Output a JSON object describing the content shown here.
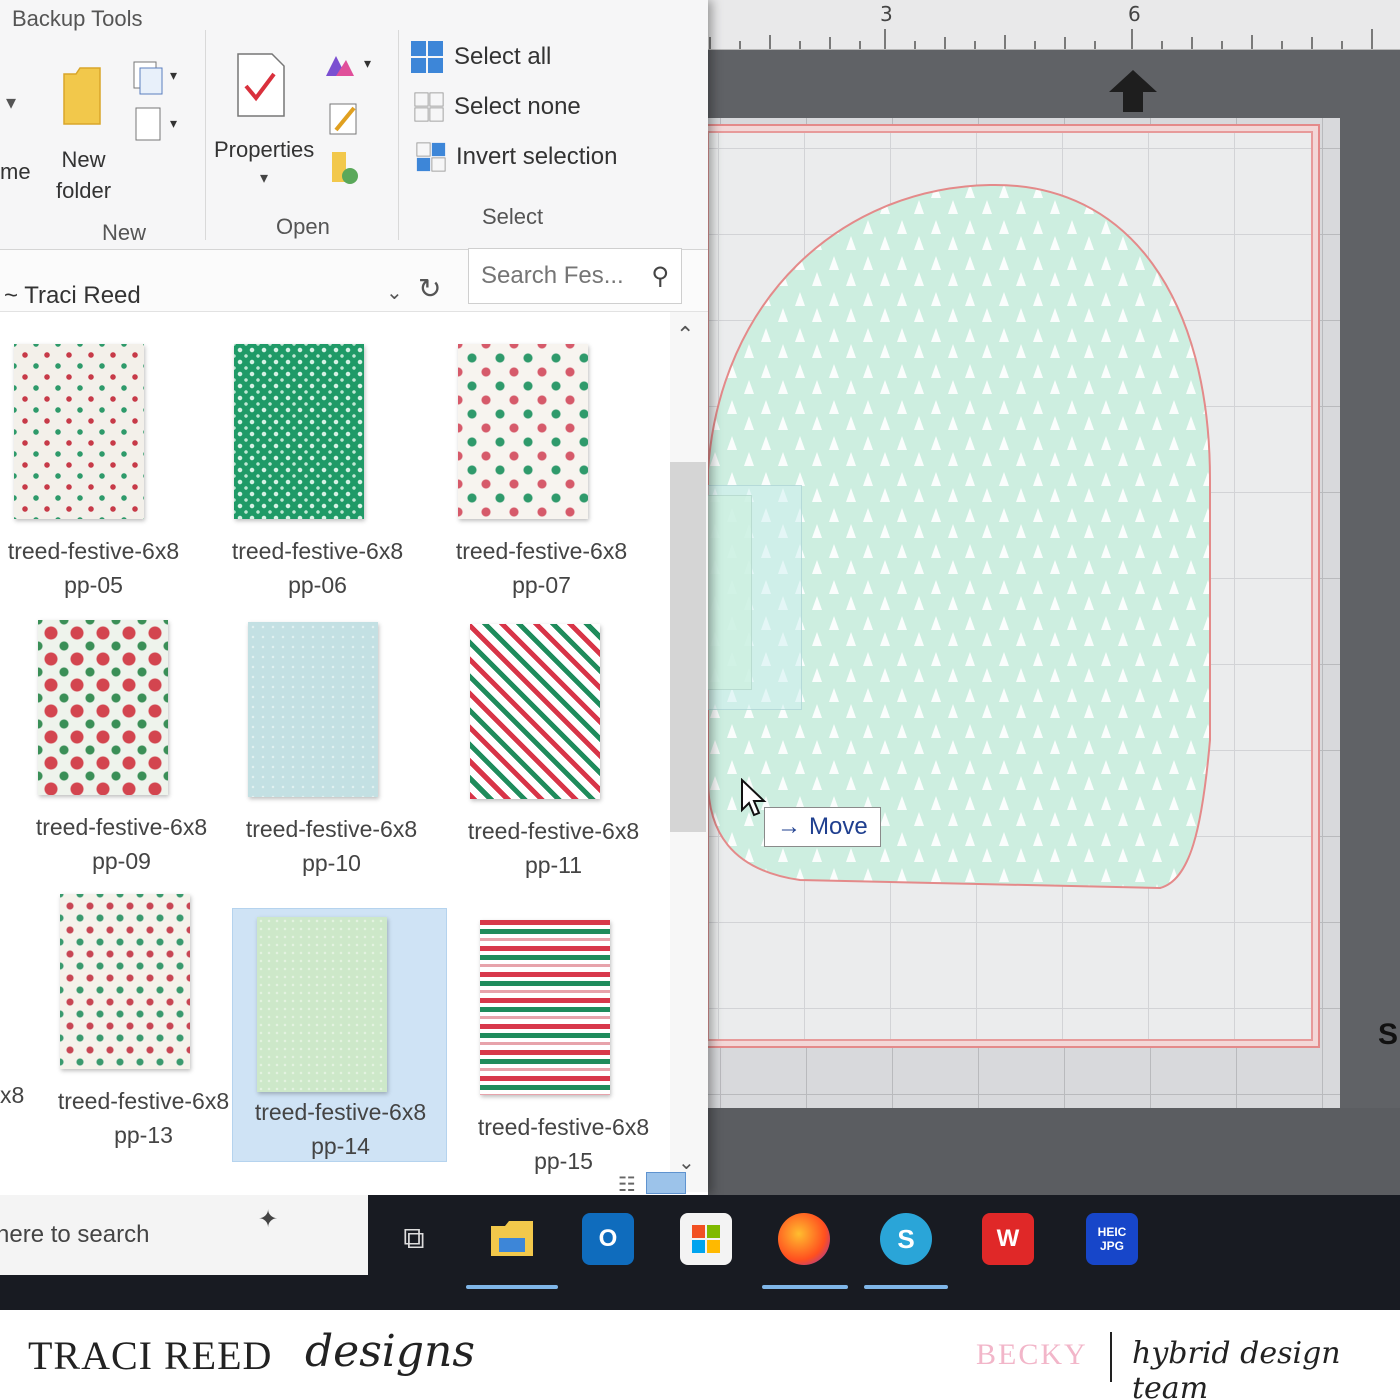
{
  "ribbon": {
    "tab_title": "Backup Tools",
    "new_partial_label": "me",
    "new_folder_label": "New\nfolder",
    "properties_label": "Properties",
    "group_new": "New",
    "group_open": "Open",
    "group_select": "Select",
    "select_all": "Select all",
    "select_none": "Select none",
    "invert_selection": "Invert selection"
  },
  "address": {
    "path": "~ Traci Reed",
    "search_placeholder": "Search Fes..."
  },
  "files": [
    {
      "line1": "treed-festive-6x8",
      "line2": "pp-05",
      "pattern": "sparkle"
    },
    {
      "line1": "treed-festive-6x8",
      "line2": "pp-06",
      "pattern": "green"
    },
    {
      "line1": "treed-festive-6x8",
      "line2": "pp-07",
      "pattern": "snowflake"
    },
    {
      "line1": "treed-festive-6x8",
      "line2": "pp-09",
      "pattern": "poinsettia"
    },
    {
      "line1": "treed-festive-6x8",
      "line2": "pp-10",
      "pattern": "lightblue"
    },
    {
      "line1": "treed-festive-6x8",
      "line2": "pp-11",
      "pattern": "diagonal-stripe"
    },
    {
      "line1": "treed-festive-6x8",
      "line2": "pp-13",
      "pattern": "ornament"
    },
    {
      "line1": "treed-festive-6x8",
      "line2": "pp-14",
      "pattern": "mint",
      "selected": true
    },
    {
      "line1": "treed-festive-6x8",
      "line2": "pp-15",
      "pattern": "horizontal-stripe"
    }
  ],
  "partial_file_label": "x8",
  "canvas": {
    "ruler_numbers": [
      "3",
      "6"
    ],
    "drag_tooltip": "Move",
    "shape_color": "#cdeee0",
    "mat_edge_mark": "S"
  },
  "taskbar": {
    "search_text": "here to search",
    "apps": [
      "task-view",
      "file-explorer",
      "outlook",
      "microsoft-store",
      "firefox",
      "silhouette-studio",
      "wps-office",
      "heic-to-jpg"
    ],
    "heic_label_top": "HEIC",
    "heic_label_bottom": "JPG"
  },
  "footer": {
    "brand_name": "TRACI REED",
    "brand_script": "designs",
    "author": "BECKY",
    "team": "hybrid design team"
  },
  "colors": {
    "accent_pink": "#f2b6c9",
    "cut_line": "#e48a8a",
    "selection": "#cfe3f5"
  }
}
